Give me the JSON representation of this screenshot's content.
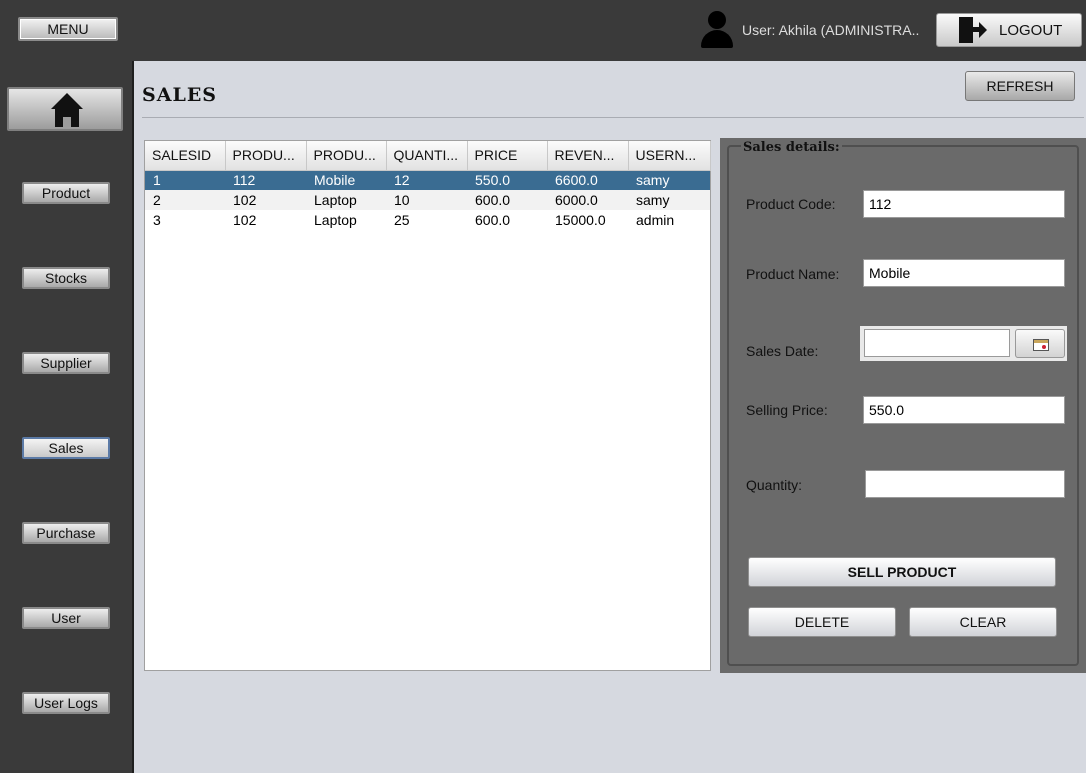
{
  "topbar": {
    "menu_label": "MENU",
    "user_text": "User: Akhila (ADMINISTRA..",
    "logout_label": "LOGOUT"
  },
  "sidebar": {
    "items": [
      {
        "label": "Product"
      },
      {
        "label": "Stocks"
      },
      {
        "label": "Supplier"
      },
      {
        "label": "Sales",
        "active": true
      },
      {
        "label": "Purchase"
      },
      {
        "label": "User"
      },
      {
        "label": "User Logs"
      }
    ]
  },
  "page": {
    "title": "SALES",
    "refresh_label": "REFRESH"
  },
  "table": {
    "columns": [
      "SALESID",
      "PRODU...",
      "PRODU...",
      "QUANTI...",
      "PRICE",
      "REVEN...",
      "USERN..."
    ],
    "rows": [
      [
        "1",
        "112",
        "Mobile",
        "12",
        "550.0",
        "6600.0",
        "samy"
      ],
      [
        "2",
        "102",
        "Laptop",
        "10",
        "600.0",
        "6000.0",
        "samy"
      ],
      [
        "3",
        "102",
        "Laptop",
        "25",
        "600.0",
        "15000.0",
        "admin"
      ]
    ],
    "selected_row": 0
  },
  "details": {
    "legend": "Sales details:",
    "product_code_label": "Product Code:",
    "product_code_value": "112",
    "product_name_label": "Product Name:",
    "product_name_value": "Mobile",
    "sales_date_label": "Sales Date:",
    "sales_date_value": "",
    "selling_price_label": "Selling Price:",
    "selling_price_value": "550.0",
    "quantity_label": "Quantity:",
    "quantity_value": "",
    "sell_label": "SELL PRODUCT",
    "delete_label": "DELETE",
    "clear_label": "CLEAR"
  },
  "colors": {
    "bar_bg": "#3a3a3a",
    "content_bg": "#d6d9e0",
    "selected_row": "#3a6c92",
    "panel_bg": "#6a6a6a"
  }
}
